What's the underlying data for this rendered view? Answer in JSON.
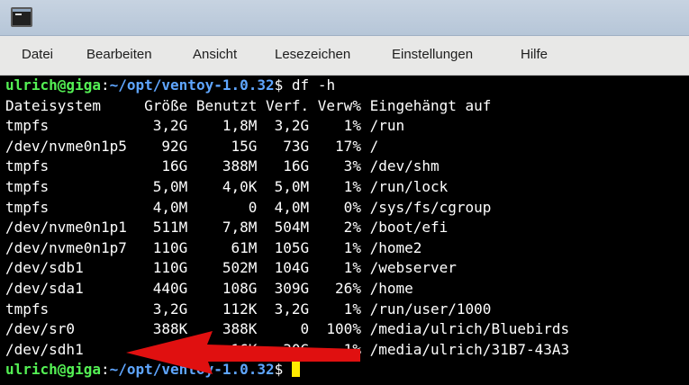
{
  "menubar": {
    "items": [
      "Datei",
      "Bearbeiten",
      "Ansicht",
      "Lesezeichen",
      "Einstellungen",
      "Hilfe"
    ]
  },
  "terminal": {
    "prompt_user": "ulrich@giga",
    "prompt_sep": ":",
    "prompt_path": "~/opt/ventoy-1.0.32",
    "prompt_dollar": "$",
    "command": " df -h",
    "output_lines": [
      "Dateisystem     Größe Benutzt Verf. Verw% Eingehängt auf",
      "tmpfs            3,2G    1,8M  3,2G    1% /run",
      "/dev/nvme0n1p5    92G     15G   73G   17% /",
      "tmpfs             16G    388M   16G    3% /dev/shm",
      "tmpfs            5,0M    4,0K  5,0M    1% /run/lock",
      "tmpfs            4,0M       0  4,0M    0% /sys/fs/cgroup",
      "/dev/nvme0n1p1   511M    7,8M  504M    2% /boot/efi",
      "/dev/nvme0n1p7   110G     61M  105G    1% /home2",
      "/dev/sdb1        110G    502M  104G    1% /webserver",
      "/dev/sda1        440G    108G  309G   26% /home",
      "tmpfs            3,2G    112K  3,2G    1% /run/user/1000",
      "/dev/sr0         388K    388K     0  100% /media/ulrich/Bluebirds",
      "/dev/sdh1         30G     16K   30G    1% /media/ulrich/31B7-43A3"
    ]
  },
  "colors": {
    "prompt_user": "#54f054",
    "prompt_path": "#5fa6ff",
    "cursor": "#ffea00",
    "annotation_arrow": "#e01010"
  },
  "icons": {
    "window_icon": "terminal-icon"
  }
}
